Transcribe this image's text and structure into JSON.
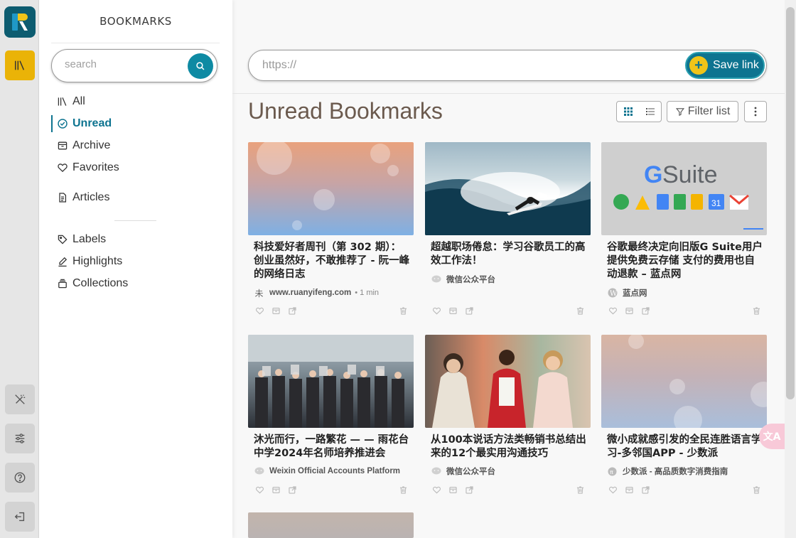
{
  "sidebar": {
    "title": "BOOKMARKS",
    "search_placeholder": "search",
    "nav": {
      "all": "All",
      "unread": "Unread",
      "archive": "Archive",
      "favorites": "Favorites",
      "articles": "Articles",
      "labels": "Labels",
      "highlights": "Highlights",
      "collections": "Collections"
    }
  },
  "header": {
    "url_placeholder": "https://",
    "save_label": "Save link"
  },
  "main": {
    "page_title": "Unread Bookmarks",
    "filter_label": "Filter list"
  },
  "cards": [
    {
      "title": "科技爱好者周刊（第 302 期）：创业虽然好，不敢推荐了 - 阮一峰的网络日志",
      "source": "www.ruanyifeng.com",
      "reading_time": "• 1 min",
      "source_icon": "ruanyifeng-icon"
    },
    {
      "title": "超越职场倦怠：学习谷歌员工的高效工作法！",
      "source": "微信公众平台",
      "source_icon": "wechat-icon"
    },
    {
      "title": "谷歌最终决定向旧版G Suite用户提供免费云存储 支付的费用也自动退款 – 蓝点网",
      "source": "蓝点网",
      "source_icon": "wordpress-icon",
      "thumb_text": "Suite"
    },
    {
      "title": "沐光而行，一路繁花 — — 雨花台中学2024年名师培养推进会",
      "source": "Weixin Official Accounts Platform",
      "source_icon": "wechat-icon"
    },
    {
      "title": "从100本说话方法类畅销书总结出来的12个最实用沟通技巧",
      "source": "微信公众平台",
      "source_icon": "wechat-icon"
    },
    {
      "title": "微小成就感引发的全民连胜语言学习-多邻国APP - 少数派",
      "source": "少数派 - 高品质数字消费指南",
      "source_icon": "sspai-icon"
    }
  ],
  "translate_fab": "文A",
  "colors": {
    "accent": "#0e7490",
    "brand_yellow": "#eab307"
  }
}
